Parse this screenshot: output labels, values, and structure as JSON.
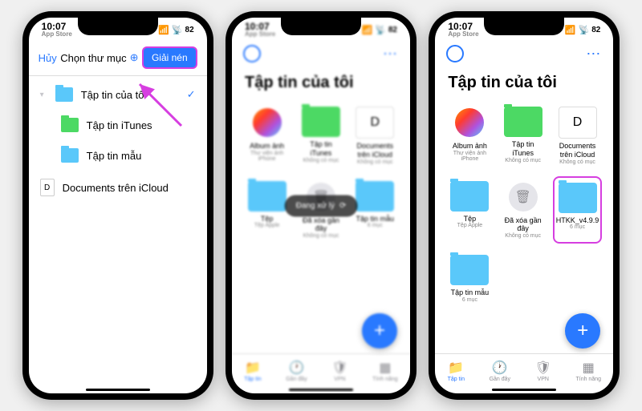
{
  "status": {
    "time": "10:07",
    "app": "App Store",
    "battery": "82"
  },
  "phone1": {
    "header": {
      "cancel": "Hủy",
      "title": "Chọn thư mục",
      "action": "Giải nén"
    },
    "rows": [
      {
        "name": "Tập tin của tôi",
        "color": "blue",
        "checked": true,
        "indent": false
      },
      {
        "name": "Tập tin iTunes",
        "color": "green",
        "indent": true
      },
      {
        "name": "Tập tin mẫu",
        "color": "blue",
        "indent": true
      },
      {
        "name": "Documents trên iCloud",
        "color": "doc",
        "indent": false
      }
    ]
  },
  "phone2": {
    "title": "Tập tin của tôi",
    "toast": "Đang xử lý",
    "items": [
      {
        "label": "Album ảnh",
        "sub": "Thư viện ảnh iPhone",
        "icon": "photos"
      },
      {
        "label": "Tập tin iTunes",
        "sub": "Không có mục",
        "icon": "green"
      },
      {
        "label": "Documents trên iCloud",
        "sub": "Không có mục",
        "icon": "doc"
      },
      {
        "label": "Tệp",
        "sub": "Tệp Apple",
        "icon": "blue"
      },
      {
        "label": "Đã xóa gần đây",
        "sub": "Không có mục",
        "icon": "bell"
      },
      {
        "label": "Tập tin mẫu",
        "sub": "6 mục",
        "icon": "blue"
      }
    ]
  },
  "phone3": {
    "title": "Tập tin của tôi",
    "items": [
      {
        "label": "Album ảnh",
        "sub": "Thư viện ảnh iPhone",
        "icon": "photos"
      },
      {
        "label": "Tập tin iTunes",
        "sub": "Không có mục",
        "icon": "green"
      },
      {
        "label": "Documents trên iCloud",
        "sub": "Không có mục",
        "icon": "doc"
      },
      {
        "label": "Tệp",
        "sub": "Tệp Apple",
        "icon": "blue"
      },
      {
        "label": "Đã xóa gần đây",
        "sub": "Không có mục",
        "icon": "bell"
      },
      {
        "label": "HTKK_v4.9.9",
        "sub": "6 mục",
        "icon": "blue",
        "hl": true
      },
      {
        "label": "Tập tin mẫu",
        "sub": "6 mục",
        "icon": "blue"
      }
    ]
  },
  "tabs": [
    "Tập tin",
    "Gần đây",
    "VPN",
    "Tính năng"
  ]
}
